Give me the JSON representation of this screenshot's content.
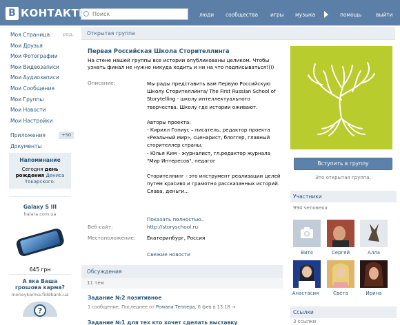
{
  "header": {
    "logo_letter": "В",
    "logo_text": "КОНТАКТЕ",
    "search_placeholder": "Поиск",
    "nav": [
      "люди",
      "сообщества",
      "игры",
      "музыка",
      "помощь",
      "выйти"
    ]
  },
  "left_menu": {
    "items": [
      "Моя Страница",
      "Мои Друзья",
      "Мои Фотографии",
      "Мои Видеозаписи",
      "Мои Аудиозаписи",
      "Мои Сообщения",
      "Мои Группы",
      "Мои Новости",
      "Мои Настройки"
    ],
    "edit_label": "ред.",
    "apps_label": "Приложения",
    "apps_badge": "+50",
    "docs_label": "Документы"
  },
  "reminder": {
    "title": "Напоминание",
    "line1": "Сегодня",
    "line1b": "день",
    "line2": "рождения",
    "name": "Дениса Токарского."
  },
  "ad1": {
    "title": "Galaxy S III",
    "subtitle": "halara.com.ua",
    "price": "645 грн"
  },
  "ad2": {
    "title": "А яка Ваша грошова карма?",
    "subtitle": "moneykarma.fiddbank.ua",
    "glyph": "?"
  },
  "page": {
    "topbar": "Открытая группа",
    "group_name": "Первая Российская Школа Сторителлинга",
    "status": "На стене нашей группы все истории опубликованы целиком. Чтобы узнать финал не нужно никуда ходить и ни на что подписываться!)))",
    "labels": {
      "description": "Описание:",
      "website": "Веб-сайт:",
      "location": "Местоположение:"
    },
    "description": [
      "Мы рады представить вам Первую Российскую Школу Сторителлинга/ The First Russian School of Storytelling - школу интеллектуального творчества. Школу где истории оживают.",
      "",
      "Авторы проекта:",
      "- Кирилл Гопиус – писатель, редактор проекта «Реальный мир», сценарист, блоггер, главный сторителлер страны.",
      "- Юлья Ким - журналист, гл.редактор журнала \"Мир Интересов\", педагог",
      "",
      "Сторителлинг - это инструмент реализации целей путем красиво и грамотно рассказанных историй.",
      "Слава, деньги..."
    ],
    "show_more": "Показать полностью..",
    "website": "http://storyschool.ru",
    "location": "Екатеринбург, Россия",
    "fresh_news": "Свежие новости"
  },
  "discussions": {
    "title": "Обсуждения",
    "count": "11 тем",
    "topic1_title": "Задание №2 позитивное",
    "topic1_meta_a": "1 сообщение. Последнее от",
    "topic1_author": "Романа Теппера",
    "topic1_meta_b": ", 6 фев в 13:18",
    "topic1_arrow": "→",
    "topic2_title": "Задание №1 для тех кто хочет сделать выставку"
  },
  "sidebar": {
    "join_button": "Вступить в группу",
    "open_group": "Это открытая группа.",
    "members_title": "Участники",
    "members_count": "994 человека",
    "members": [
      "Витя",
      "Сергей",
      "Алла",
      "Анастасия",
      "Света",
      "Ирина"
    ],
    "links_title": "Ссылки",
    "links_count": "3 ссылки"
  },
  "colors": {
    "brand": "#5b7fa6",
    "link": "#2b587a",
    "avatar_bg": "#b9cc2e"
  }
}
